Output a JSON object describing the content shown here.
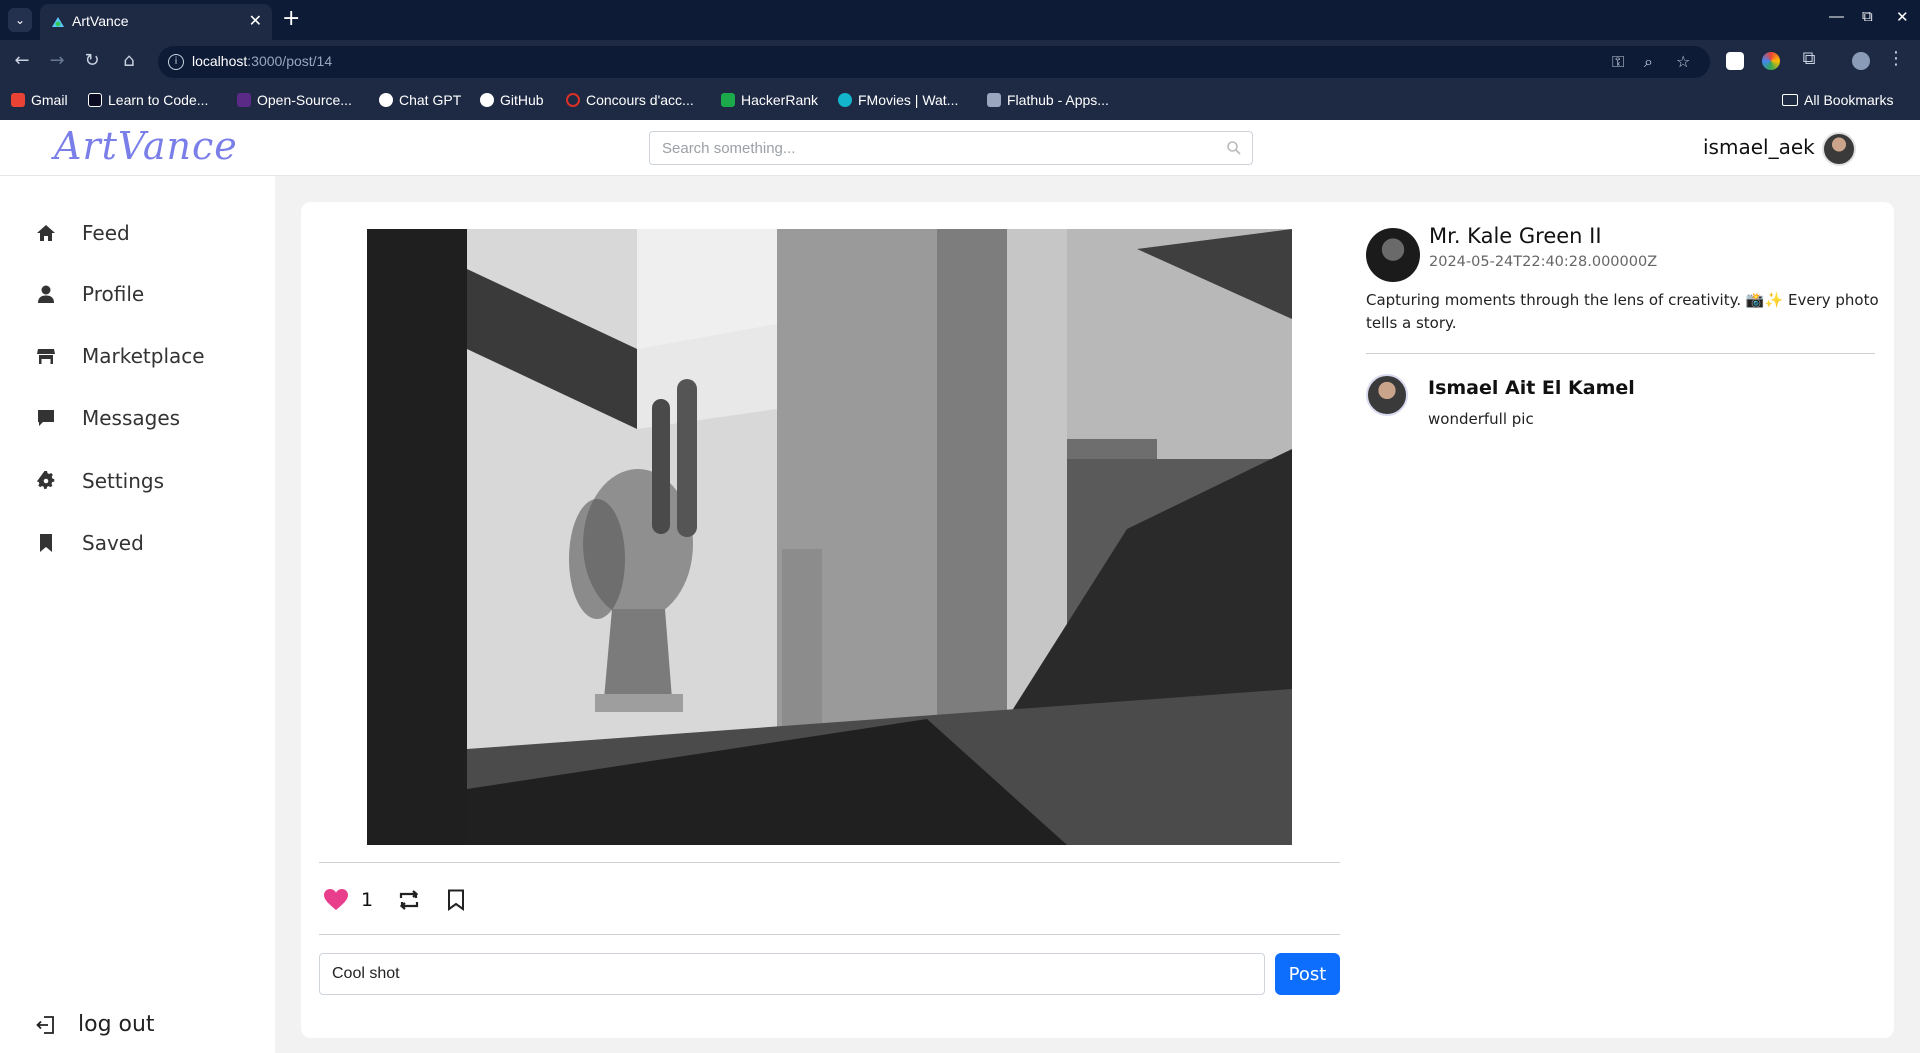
{
  "browser": {
    "tab_title": "ArtVance",
    "url_host": "localhost",
    "url_path": ":3000/post/14",
    "bookmarks": [
      {
        "label": "Gmail",
        "color": "#ea4335"
      },
      {
        "label": "Learn to Code...",
        "color": "#0a0a23"
      },
      {
        "label": "Open-Source...",
        "color": "#5b2a86"
      },
      {
        "label": "Chat GPT",
        "color": "#ffffff"
      },
      {
        "label": "GitHub",
        "color": "#ffffff"
      },
      {
        "label": "Concours d'acc...",
        "color": "#d93025"
      },
      {
        "label": "HackerRank",
        "color": "#1ba94c"
      },
      {
        "label": "FMovies | Wat...",
        "color": "#12b5cb"
      },
      {
        "label": "Flathub - Apps...",
        "color": "#9aa6bd"
      }
    ],
    "all_bookmarks": "All Bookmarks"
  },
  "header": {
    "logo": "ArtVance",
    "search_placeholder": "Search something...",
    "username": "ismael_aek"
  },
  "sidebar": {
    "items": [
      {
        "label": "Feed",
        "icon": "home-icon"
      },
      {
        "label": "Profile",
        "icon": "user-icon"
      },
      {
        "label": "Marketplace",
        "icon": "store-icon"
      },
      {
        "label": "Messages",
        "icon": "message-icon"
      },
      {
        "label": "Settings",
        "icon": "gear-icon"
      },
      {
        "label": "Saved",
        "icon": "bookmark-icon"
      }
    ],
    "logout": "log out"
  },
  "post": {
    "author": "Mr. Kale Green II",
    "date": "2024-05-24T22:40:28.000000Z",
    "caption": "Capturing moments through the lens of creativity. 📸✨ Every photo tells a story.",
    "likes": "1",
    "comment_input_value": "Cool shot",
    "post_button": "Post",
    "comments": [
      {
        "name": "Ismael Ait El Kamel",
        "text": "wonderfull pic"
      }
    ]
  },
  "colors": {
    "accent": "#0d6efd",
    "heart": "#e83e8c",
    "logo": "#7a7ee8"
  }
}
